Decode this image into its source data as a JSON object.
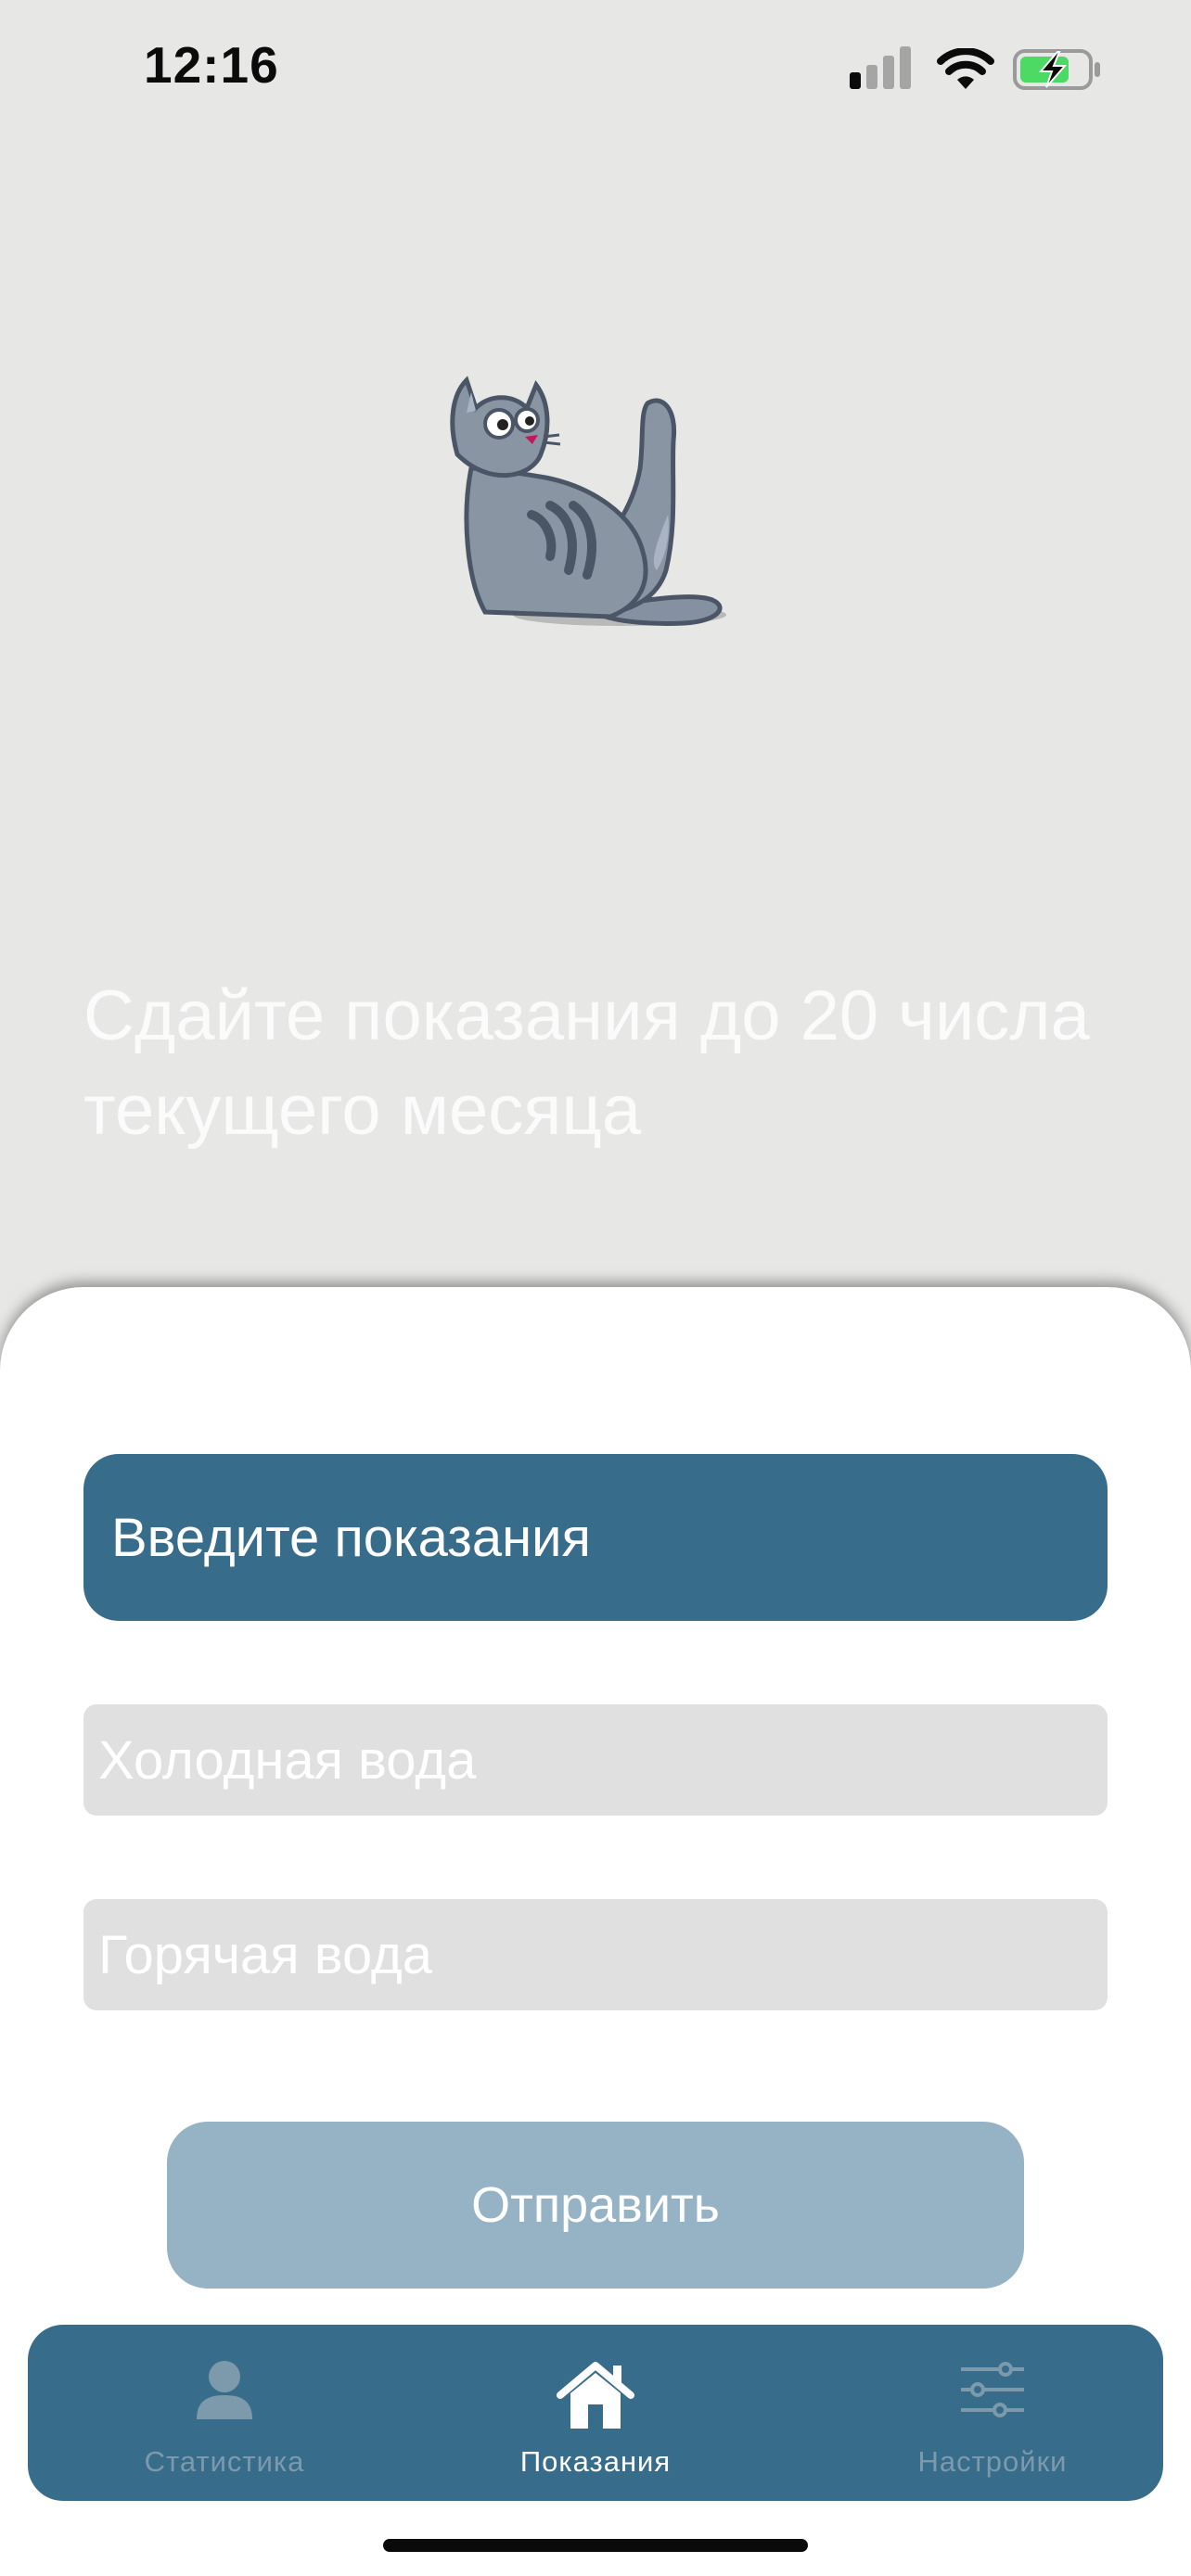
{
  "status_bar": {
    "time": "12:16",
    "icons": [
      "signal-icon",
      "wifi-icon",
      "battery-charging-icon"
    ]
  },
  "illustration": "cat-icon",
  "notice": "Сдайте показания до 20 числа текущего месяца",
  "sheet": {
    "header": "Введите показания",
    "cold_water_placeholder": "Холодная вода",
    "hot_water_placeholder": "Горячая вода",
    "submit_label": "Отправить"
  },
  "tabbar": {
    "items": [
      {
        "label": "Статистика",
        "icon": "user-icon",
        "active": false
      },
      {
        "label": "Показания",
        "icon": "home-icon",
        "active": true
      },
      {
        "label": "Настройки",
        "icon": "sliders-icon",
        "active": false
      }
    ]
  },
  "colors": {
    "primary": "#386c8b",
    "button_disabled": "#95b3c4",
    "background": "#e7e7e6",
    "field": "#e0e0e0",
    "battery_fill": "#4cd964"
  }
}
